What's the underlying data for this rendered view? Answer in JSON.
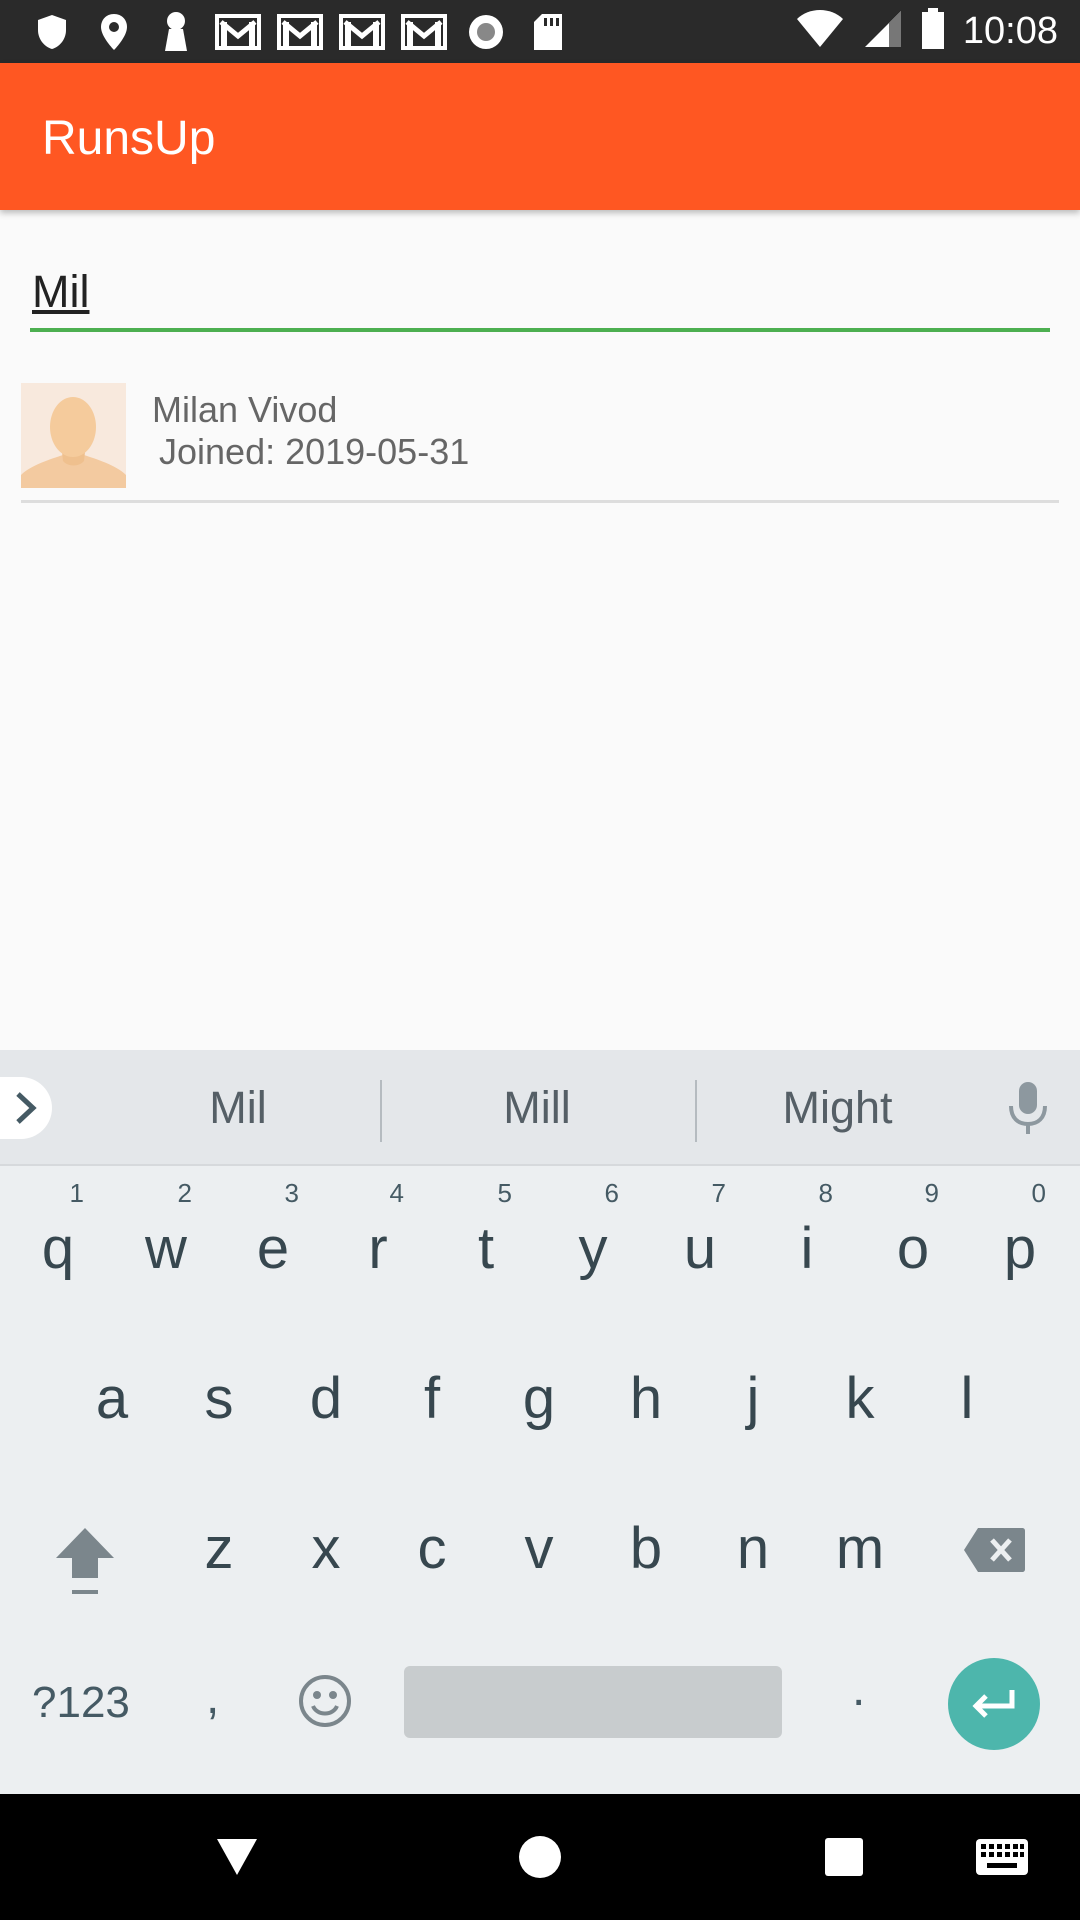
{
  "status_bar": {
    "time": "10:08",
    "left_icons": [
      "shield-icon",
      "location-pin-icon",
      "keyhole-icon",
      "gmail-icon",
      "gmail-icon",
      "gmail-icon",
      "gmail-icon",
      "record-icon",
      "sd-card-icon"
    ],
    "right_icons": [
      "wifi-icon",
      "signal-icon",
      "battery-icon"
    ]
  },
  "app_bar": {
    "title": "RunsUp"
  },
  "search": {
    "value": "Mil"
  },
  "results": [
    {
      "name": "Milan Vivod",
      "joined": " Joined: 2019-05-31"
    }
  ],
  "keyboard": {
    "suggestions": [
      "Mil",
      "Mill",
      "Might"
    ],
    "row1": [
      {
        "ch": "q",
        "hint": "1"
      },
      {
        "ch": "w",
        "hint": "2"
      },
      {
        "ch": "e",
        "hint": "3"
      },
      {
        "ch": "r",
        "hint": "4"
      },
      {
        "ch": "t",
        "hint": "5"
      },
      {
        "ch": "y",
        "hint": "6"
      },
      {
        "ch": "u",
        "hint": "7"
      },
      {
        "ch": "i",
        "hint": "8"
      },
      {
        "ch": "o",
        "hint": "9"
      },
      {
        "ch": "p",
        "hint": "0"
      }
    ],
    "row2": [
      "a",
      "s",
      "d",
      "f",
      "g",
      "h",
      "j",
      "k",
      "l"
    ],
    "row3": [
      "z",
      "x",
      "c",
      "v",
      "b",
      "n",
      "m"
    ],
    "symbols_label": "?123",
    "comma_label": ",",
    "period_label": "."
  },
  "colors": {
    "app_bar": "#ff5722",
    "search_underline": "#4caf50",
    "enter_key": "#4db6ac",
    "status_bar": "#2a2a2a"
  }
}
